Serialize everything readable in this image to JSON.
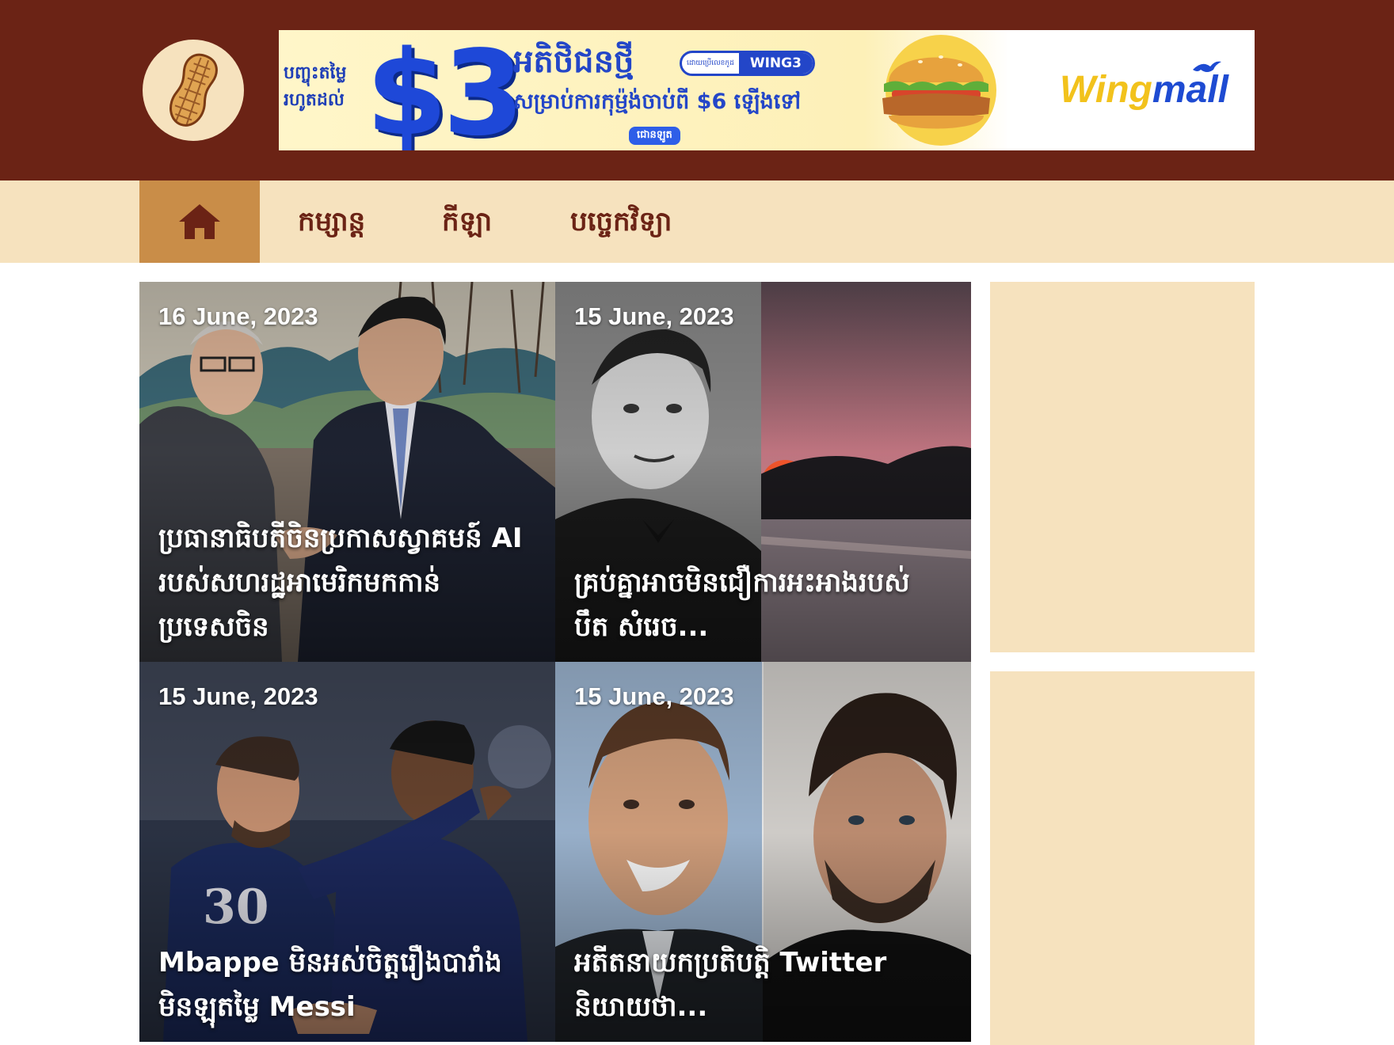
{
  "header": {
    "logo_icon": "peanut-icon",
    "ad": {
      "left_text": "បញ្ចុះតម្លៃរហូតដល់",
      "price": "$3",
      "headline": "អតិថិជនថ្មី",
      "code_prefix": "ដោយប្រើលេខកូដ",
      "code": "WING3",
      "sub": "សម្រាប់ការកុម្ម៉ង់ចាប់ពី $6 ឡើងទៅ",
      "cta": "ជោនឡូត",
      "brand_wing": "Wing",
      "brand_mall": "mall",
      "colors": {
        "blue": "#1e48d8",
        "yellow": "#f2c21c"
      }
    }
  },
  "nav": {
    "home_icon": "home-icon",
    "items": [
      {
        "label": "កម្សាន្ត"
      },
      {
        "label": "កីឡា"
      },
      {
        "label": "បច្ចេកវិទ្យា"
      }
    ]
  },
  "articles": [
    {
      "date": "16 June, 2023",
      "title": "ប្រធានាធិបតីចិនប្រកាសស្វាគមន៍ AI របស់សហរដ្ឋអាមេរិកមកកាន់ប្រទេសចិន"
    },
    {
      "date": "15 June, 2023",
      "title": "គ្រប់គ្នាអាចមិនជឿការអះអាងរបស់ បឹត សំរេច..."
    },
    {
      "date": "15 June, 2023",
      "title": "Mbappe មិនអស់ចិត្តរឿងបារាំងមិនឡុតម្លៃ Messi"
    },
    {
      "date": "15 June, 2023",
      "title": "អតីតនាយកប្រតិបត្តិ Twitter និយាយថា..."
    }
  ],
  "colors": {
    "header_bg": "#6b2315",
    "nav_bg": "#f6e2be",
    "nav_active": "#c98d48",
    "nav_text": "#6b2315",
    "sidebar_bg": "#f6e2be"
  }
}
